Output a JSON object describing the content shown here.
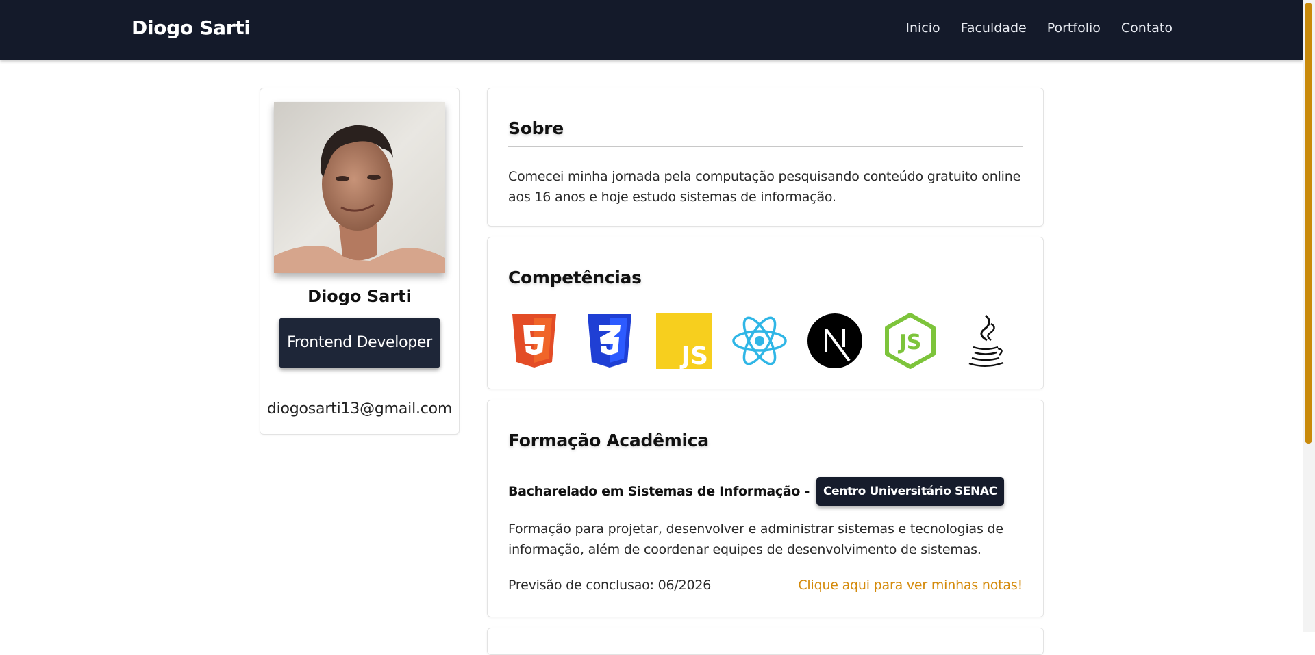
{
  "navbar": {
    "brand": "Diogo Sarti",
    "links": [
      "Inicio",
      "Faculdade",
      "Portfolio",
      "Contato"
    ]
  },
  "profile": {
    "name": "Diogo Sarti",
    "role_button": "Frontend Developer",
    "email": "diogosarti13@gmail.com"
  },
  "about": {
    "title": "Sobre",
    "text": "Comecei minha jornada pela computação pesquisando conteúdo gratuito online aos 16 anos e hoje estudo sistemas de informação."
  },
  "skills": {
    "title": "Competências",
    "icons": [
      "html5-icon",
      "css3-icon",
      "javascript-icon",
      "react-icon",
      "nextjs-icon",
      "nodejs-icon",
      "java-icon"
    ]
  },
  "education": {
    "title": "Formação Acadêmica",
    "degree": "Bacharelado em Sistemas de Informação -",
    "institution": "Centro Universitário SENAC",
    "description": "Formação para projetar, desenvolver e administrar sistemas e tecnologias de informação, além de coordenar equipes de desenvolvimento de sistemas.",
    "forecast": "Previsão de conclusao: 06/2026",
    "grades_link": "Clique aqui para ver minhas notas!"
  },
  "colors": {
    "navbar_bg": "#141a2a",
    "accent": "#d48a0b",
    "button_bg": "#1e2638"
  }
}
